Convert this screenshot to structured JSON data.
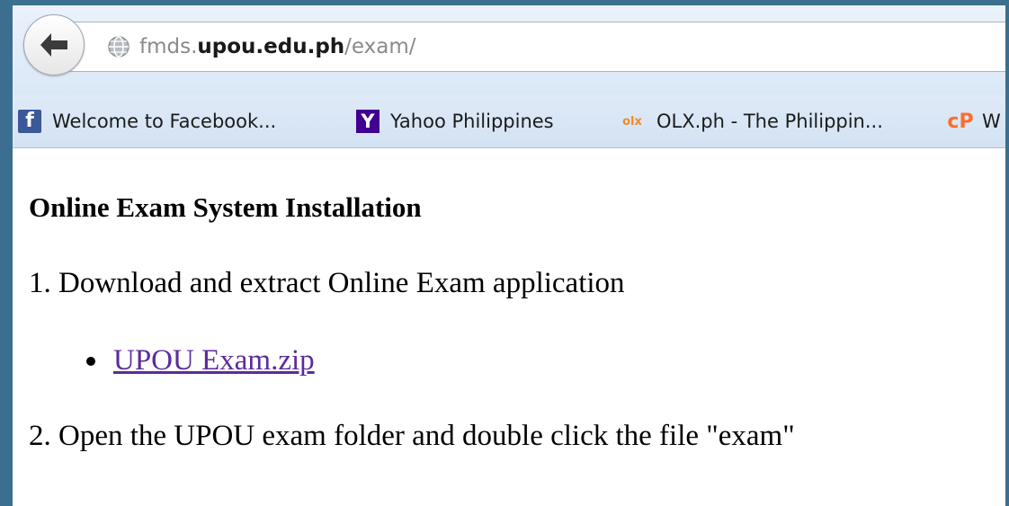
{
  "browser": {
    "back_button_label": "Back",
    "address_bar": {
      "subdomain": "fmds.",
      "host_bold": "upou.edu.ph",
      "path": "/exam/"
    },
    "bookmarks": [
      {
        "icon": "facebook-icon",
        "icon_glyph": "f",
        "label": "Welcome to Facebook..."
      },
      {
        "icon": "yahoo-icon",
        "icon_glyph": "Y",
        "label": "Yahoo Philippines"
      },
      {
        "icon": "olx-icon",
        "icon_glyph": "olx",
        "label": "OLX.ph - The Philippin..."
      },
      {
        "icon": "cpanel-icon",
        "icon_glyph": "cP",
        "label": "W"
      }
    ]
  },
  "page": {
    "heading": "Online Exam System Installation",
    "step1": "1. Download and extract Online Exam application",
    "download_link": "UPOU Exam.zip",
    "step2": "2. Open the UPOU exam folder and double click the file \"exam\""
  },
  "colors": {
    "background_outer": "#3c6f8f",
    "link_visited": "#5b2c9c",
    "facebook_blue": "#3b5998",
    "yahoo_purple": "#400090",
    "olx_orange": "#f08a24",
    "cpanel_orange": "#ff6c2c"
  }
}
